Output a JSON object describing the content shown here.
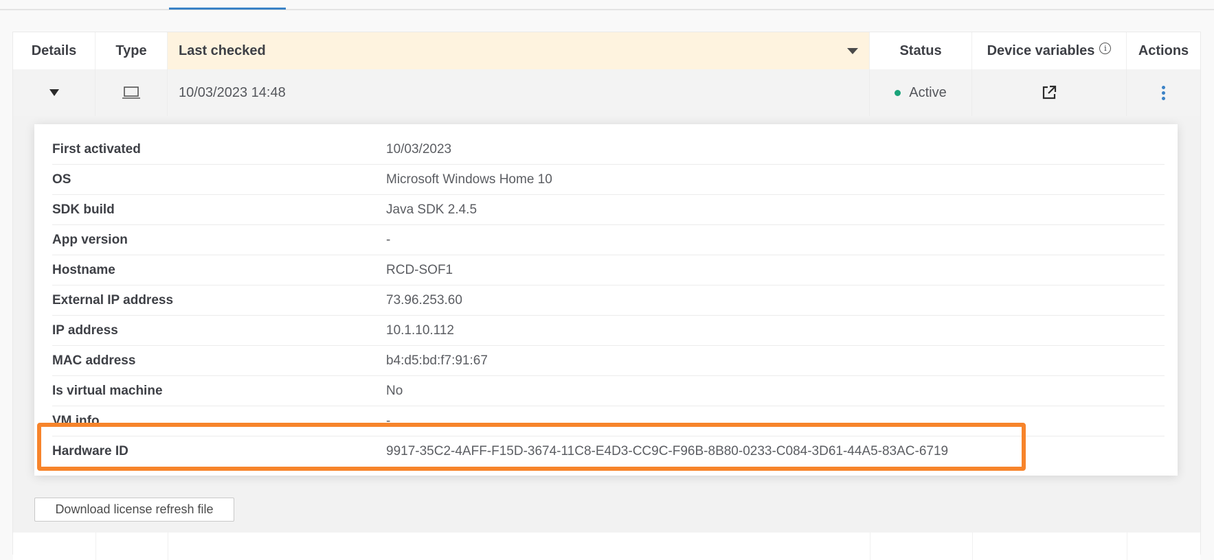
{
  "table": {
    "columns": [
      {
        "key": "details",
        "label": "Details"
      },
      {
        "key": "type",
        "label": "Type"
      },
      {
        "key": "last_checked",
        "label": "Last checked",
        "sorted": true,
        "sort_direction": "descending"
      },
      {
        "key": "status",
        "label": "Status"
      },
      {
        "key": "device_variables",
        "label": "Device variables",
        "info_icon": "info-icon"
      },
      {
        "key": "actions",
        "label": "Actions"
      }
    ],
    "rows": [
      {
        "expanded": true,
        "expand_icon": "caret-down-icon",
        "type_icon": "laptop-icon",
        "last_checked": "10/03/2023 14:48",
        "status": "Active",
        "status_color": "#1aa37a",
        "device_variables_icon": "external-link-icon",
        "actions_icon": "overflow-menu-vertical-icon",
        "details": [
          {
            "label": "First activated",
            "value": "10/03/2023"
          },
          {
            "label": "OS",
            "value": "Microsoft Windows Home 10"
          },
          {
            "label": "SDK build",
            "value": "Java SDK 2.4.5"
          },
          {
            "label": "App version",
            "value": "-"
          },
          {
            "label": "Hostname",
            "value": "RCD-SOF1"
          },
          {
            "label": "External IP address",
            "value": "73.96.253.60"
          },
          {
            "label": "IP address",
            "value": "10.1.10.112"
          },
          {
            "label": "MAC address",
            "value": "b4:d5:bd:f7:91:67"
          },
          {
            "label": "Is virtual machine",
            "value": "No"
          },
          {
            "label": "VM info",
            "value": "-"
          },
          {
            "label": "Hardware ID",
            "value": "9917-35C2-4AFF-F15D-3674-11C8-E4D3-CC9C-F96B-8B80-0233-C084-3D61-44A5-83AC-6719",
            "highlighted": true
          }
        ],
        "download_button_label": "Download license refresh file"
      }
    ]
  },
  "colors": {
    "accent": "#3b82c6",
    "highlight": "#f7842b",
    "sorted_header_bg": "#fef3df",
    "status_active": "#1aa37a"
  }
}
